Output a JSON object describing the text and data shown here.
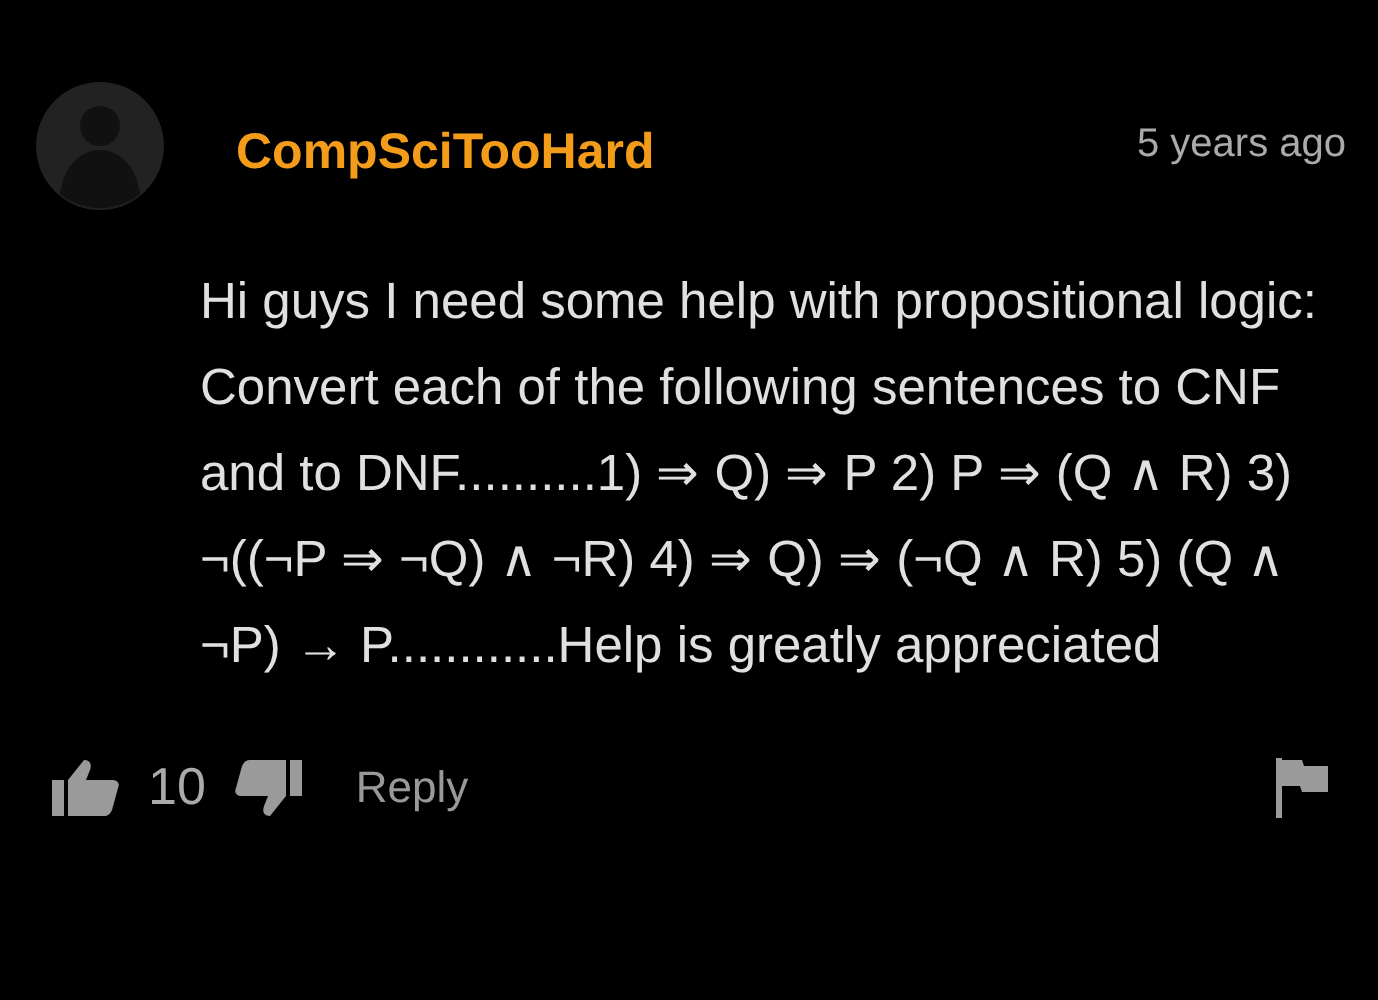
{
  "comment": {
    "author": "CompSciTooHard",
    "time": "5 years ago",
    "text": "Hi guys I need some help with propositional logic: Convert each of the following sentences to CNF and to DNF..........1) ⇒ Q) ⇒ P 2) P ⇒ (Q ∧ R) 3) ¬((¬P ⇒ ¬Q) ∧ ¬R) 4) ⇒ Q) ⇒ (¬Q ∧ R) 5) (Q ∧ ¬P) → P............Help is greatly appreciated",
    "likes": "10",
    "reply": "Reply"
  }
}
